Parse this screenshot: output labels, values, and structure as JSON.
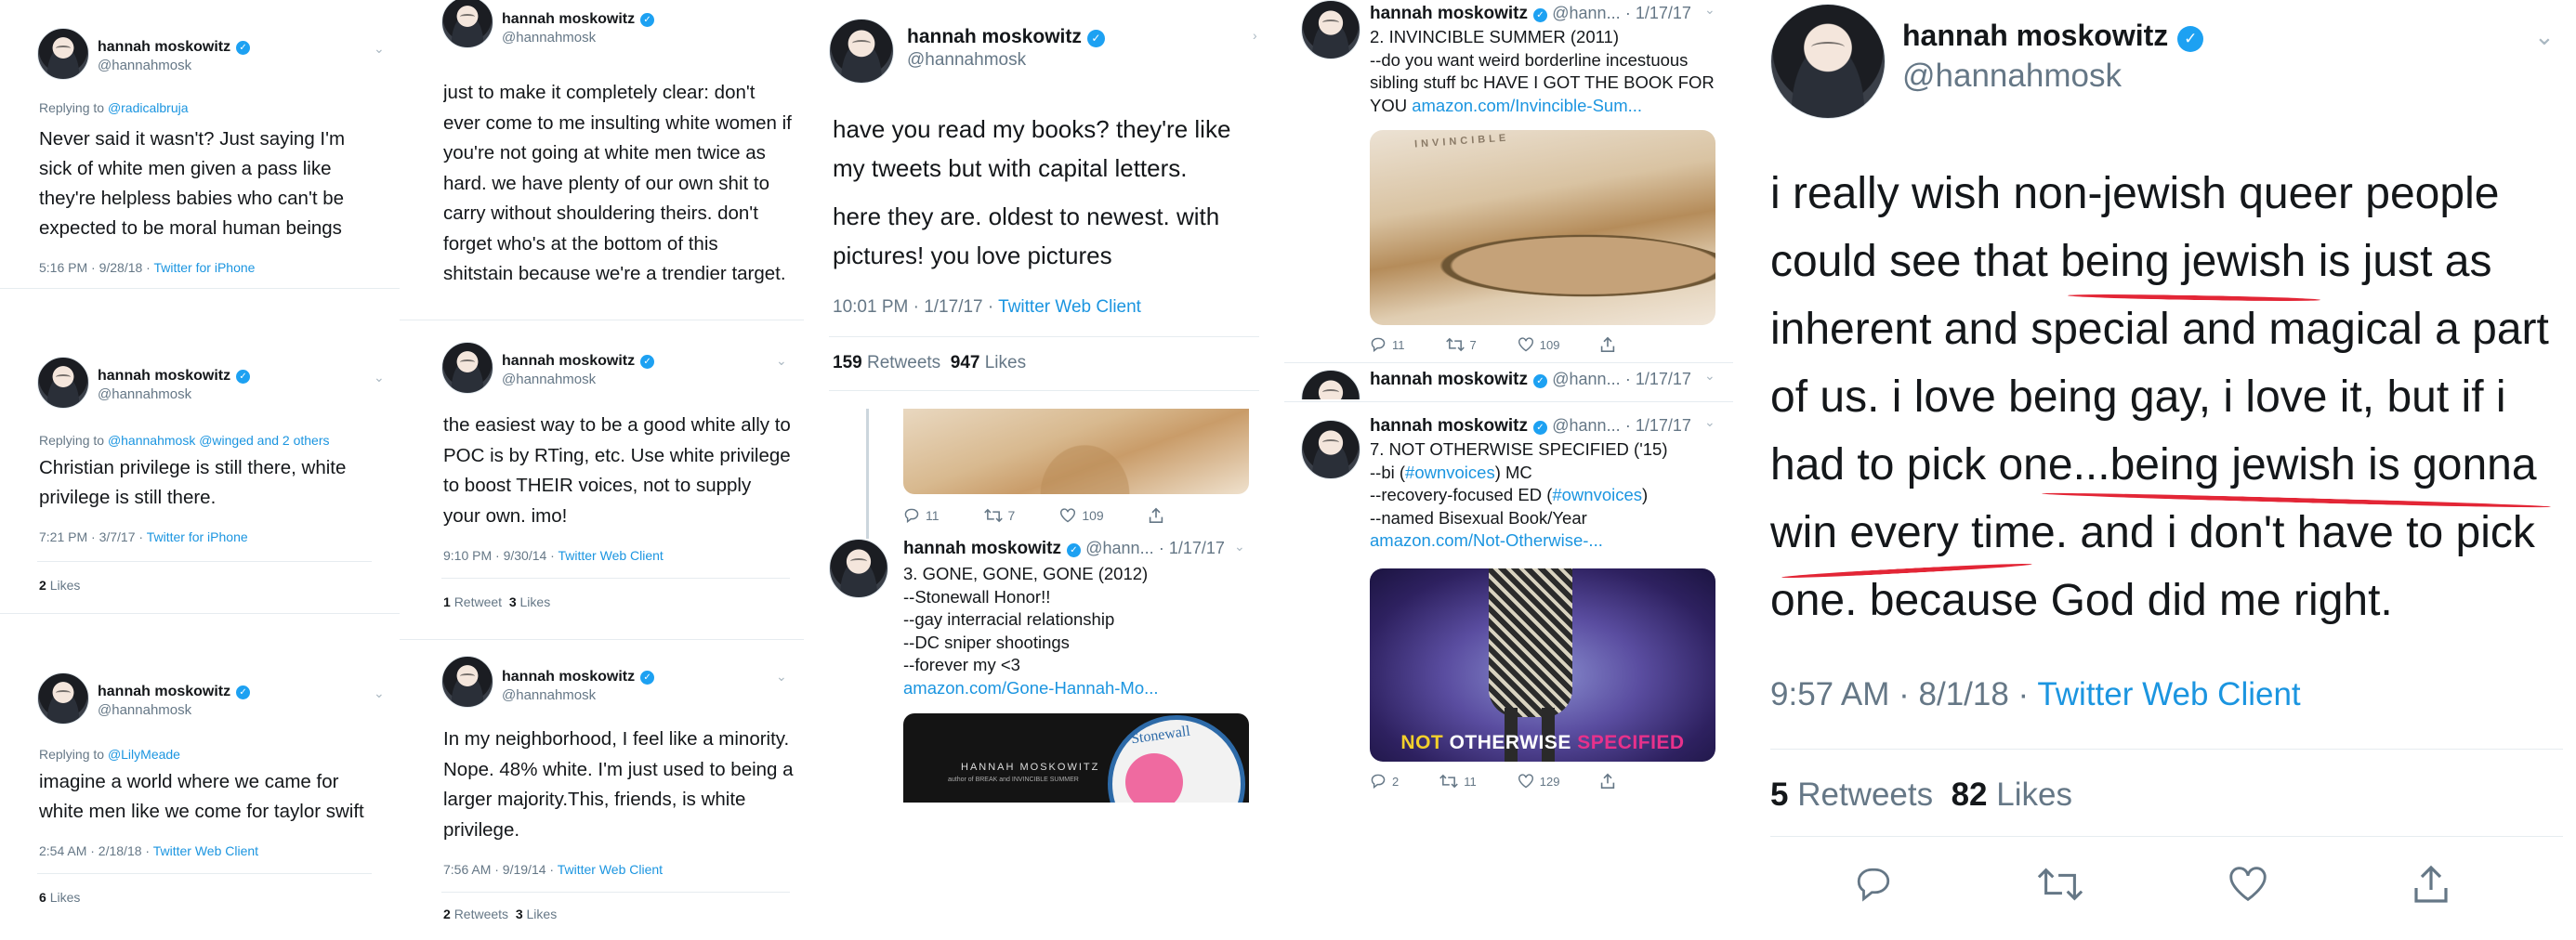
{
  "col1": {
    "t1": {
      "name": "hannah moskowitz",
      "handle": "@hannahmosk",
      "reply_prefix": "Replying to ",
      "reply_to": "@radicalbruja",
      "text": "Never said it wasn't? Just saying I'm sick of white men given a pass like they're helpless babies who can't be expected to be moral human beings",
      "time": "5:16 PM · 9/28/18 · ",
      "client": "Twitter for iPhone"
    },
    "t2": {
      "name": "hannah moskowitz",
      "handle": "@hannahmosk",
      "reply_prefix": "Replying to ",
      "reply_to": "@hannahmosk @winged and 2 others",
      "text": "Christian privilege is still there, white privilege is still there.",
      "time": "7:21 PM · 3/7/17 · ",
      "client": "Twitter for iPhone",
      "likes_n": "2",
      "likes_l": "Likes"
    },
    "t3": {
      "name": "hannah moskowitz",
      "handle": "@hannahmosk",
      "reply_prefix": "Replying to ",
      "reply_to": "@LilyMeade",
      "text": "imagine a world where we came for white men like we come for taylor swift",
      "time": "2:54 AM · 2/18/18 · ",
      "client": "Twitter Web Client",
      "likes_n": "6",
      "likes_l": "Likes"
    }
  },
  "col2": {
    "t1": {
      "name": "hannah moskowitz",
      "handle": "@hannahmosk",
      "text": "just to make it completely clear: don't ever come to me insulting white women if you're not going at white men twice as hard. we have plenty of our own shit to carry without shouldering theirs. don't forget who's at the bottom of this shitstain because we're a trendier target."
    },
    "t2": {
      "name": "hannah moskowitz",
      "handle": "@hannahmosk",
      "text": "the easiest way to be a good white ally to POC is by RTing, etc. Use white privilege to boost THEIR voices, not to supply your own. imo!",
      "time": "9:10 PM · 9/30/14 · ",
      "client": "Twitter Web Client",
      "rt_n": "1",
      "rt_l": "Retweet",
      "likes_n": "3",
      "likes_l": "Likes"
    },
    "t3": {
      "name": "hannah moskowitz",
      "handle": "@hannahmosk",
      "text": "In my neighborhood, I feel like a minority. Nope. 48% white. I'm just  used to being a larger majority.This, friends, is white privilege.",
      "time": "7:56 AM · 9/19/14 · ",
      "client": "Twitter Web Client",
      "rt_n": "2",
      "rt_l": "Retweets",
      "likes_n": "3",
      "likes_l": "Likes"
    }
  },
  "col3": {
    "main": {
      "name": "hannah moskowitz",
      "handle": "@hannahmosk",
      "text1": "have you read my books? they're like my tweets but with capital letters.",
      "text2": "here they are. oldest to newest. with pictures! you love pictures",
      "time": "10:01 PM · 1/17/17 · ",
      "client": "Twitter Web Client",
      "rt_n": "159",
      "rt_l": "Retweets",
      "likes_n": "947",
      "likes_l": "Likes"
    },
    "actions1": {
      "reply": "11",
      "retweet": "7",
      "like": "109"
    },
    "reply": {
      "name": "hannah moskowitz",
      "handle": "@hann...",
      "date": "· 1/17/17",
      "lines": [
        "3. GONE, GONE, GONE (2012)",
        "--Stonewall Honor!!",
        "--gay interracial relationship",
        "--DC sniper shootings",
        "--forever my <3"
      ],
      "link": "amazon.com/Gone-Hannah-Mo..."
    },
    "cover": {
      "author": "HANNAH MOSKOWITZ",
      "sub": "author of BREAK and INVINCIBLE SUMMER",
      "seal": "Stonewall"
    }
  },
  "col4": {
    "t1": {
      "name": "hannah moskowitz",
      "handle": "@hann...",
      "date": "· 1/17/17",
      "lines": [
        "2. INVINCIBLE SUMMER (2011)",
        "--do you want weird borderline incestuous sibling stuff bc HAVE I GOT THE BOOK FOR YOU "
      ],
      "link": "amazon.com/Invincible-Sum...",
      "img_text": "INVINCIBLE",
      "reply": "11",
      "retweet": "7",
      "like": "109"
    },
    "t2": {
      "name": "hannah moskowitz",
      "handle": "@hann...",
      "date": "· 1/17/17"
    },
    "t3": {
      "name": "hannah moskowitz",
      "handle": "@hann...",
      "date": "· 1/17/17",
      "l1": "7. NOT OTHERWISE SPECIFIED ('15)",
      "l2a": "--bi (",
      "l2b": "#ownvoices",
      "l2c": ") MC",
      "l3a": "--recovery-focused ED (",
      "l3b": "#ownvoices",
      "l3c": ")",
      "l4": "--named Bisexual Book/Year",
      "link": "amazon.com/Not-Otherwise-...",
      "cover_a": "NOT ",
      "cover_b": "OTHERWISE ",
      "cover_c": "SPECIFIED",
      "reply": "2",
      "retweet": "11",
      "like": "129"
    }
  },
  "col5": {
    "name": "hannah moskowitz",
    "handle": "@hannahmosk",
    "text": "i really wish non-jewish queer people could see that being jewish is just as inherent and special and magical a part of us. i love being gay, i love it, but if i had to pick one...being jewish is gonna win every time. and i don't have to pick one. because God did me right.",
    "time": "9:57 AM · 8/1/18 · ",
    "client": "Twitter Web Client",
    "rt_n": "5",
    "rt_l": "Retweets",
    "likes_n": "82",
    "likes_l": "Likes"
  },
  "colors": {
    "accent": "#1b95e0",
    "verified": "#1da1f2",
    "muted": "#657786",
    "text": "#14171a",
    "highlight": "#e32636"
  },
  "icons": [
    "verified-badge-icon",
    "chevron-down-icon",
    "reply-icon",
    "retweet-icon",
    "like-icon",
    "share-icon"
  ]
}
